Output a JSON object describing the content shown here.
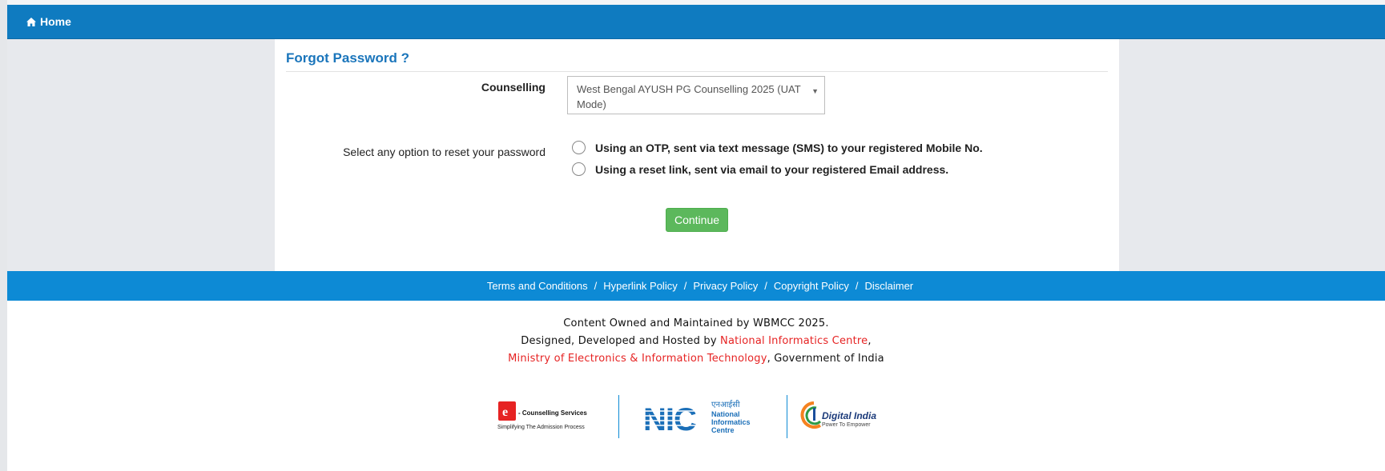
{
  "nav": {
    "home_label": "Home"
  },
  "form": {
    "title": "Forgot Password ?",
    "counselling_label": "Counselling",
    "counselling_value": "West Bengal AYUSH PG Counselling 2025 (UAT Mode)",
    "reset_label": "Select any option to reset your password",
    "options": [
      {
        "label": "Using an OTP, sent via text message (SMS) to your registered Mobile No.",
        "selected": false
      },
      {
        "label": "Using a reset link, sent via email to your registered Email address.",
        "selected": false
      }
    ],
    "continue_label": "Continue"
  },
  "footer": {
    "links": [
      "Terms and Conditions",
      "Hyperlink Policy",
      "Privacy Policy",
      "Copyright Policy",
      "Disclaimer"
    ],
    "separator": "/",
    "line1": "Content Owned and Maintained by WBMCC 2025.",
    "line2_prefix": "Designed, Developed and Hosted by ",
    "nic_name": "National Informatics Centre",
    "comma": ",",
    "ministry": "Ministry of Electronics & Information Technology",
    "line3_suffix": ", Government of India"
  },
  "logos": {
    "ecs_brand": "- Counselling Services",
    "ecs_tagline": "Simplifying The Admission Process",
    "nic_text": "NIC",
    "nic_hindi": "एनआईसी",
    "nic_name_lines": [
      "National",
      "Informatics",
      "Centre"
    ],
    "di_name": "Digital India",
    "di_tagline": "Power To Empower"
  },
  "colors": {
    "topbar": "#0f7bc0",
    "footer_bar": "#0d8ad5",
    "title": "#1a75bb",
    "button": "#5cb85c",
    "accent_red": "#e62323"
  }
}
